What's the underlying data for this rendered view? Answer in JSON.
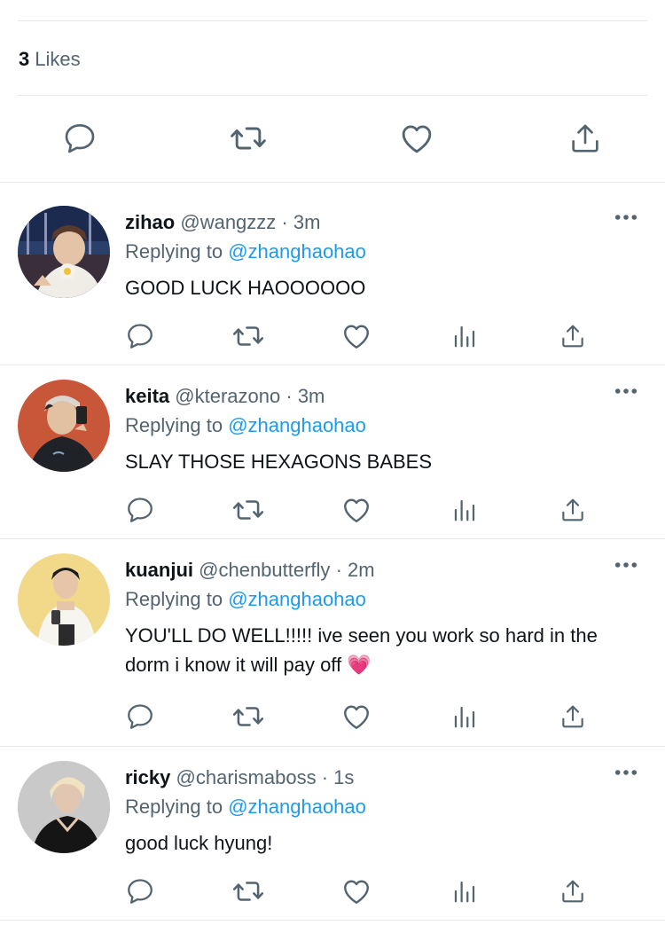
{
  "likes": {
    "count": "3",
    "label": "Likes"
  },
  "main_actions": [
    "reply-icon",
    "retweet-icon",
    "like-icon",
    "share-icon"
  ],
  "reply_actions": [
    "reply-icon",
    "retweet-icon",
    "like-icon",
    "analytics-icon",
    "share-icon"
  ],
  "colors": {
    "text": "#0f1419",
    "secondary": "#536471",
    "accent": "#1d9bf0",
    "divider": "#e6e9ec"
  },
  "replies": [
    {
      "name": "zihao",
      "handle": "@wangzzz",
      "separator": "·",
      "time": "3m",
      "replying_prefix": "Replying to",
      "replying_to": "@zhanghaohao",
      "text": "GOOD LUCK HAOOOOOO"
    },
    {
      "name": "keita",
      "handle": "@kterazono",
      "separator": "·",
      "time": "3m",
      "replying_prefix": "Replying to",
      "replying_to": "@zhanghaohao",
      "text": "SLAY THOSE HEXAGONS BABES"
    },
    {
      "name": "kuanjui",
      "handle": "@chenbutterfly",
      "separator": "·",
      "time": "2m",
      "replying_prefix": "Replying to",
      "replying_to": "@zhanghaohao",
      "text": "YOU'LL DO WELL!!!!! ive seen you work so hard in the dorm i know it will pay off 💗"
    },
    {
      "name": "ricky",
      "handle": "@charismaboss",
      "separator": "·",
      "time": "1s",
      "replying_prefix": "Replying to",
      "replying_to": "@zhanghaohao",
      "text": "good luck hyung!"
    }
  ]
}
